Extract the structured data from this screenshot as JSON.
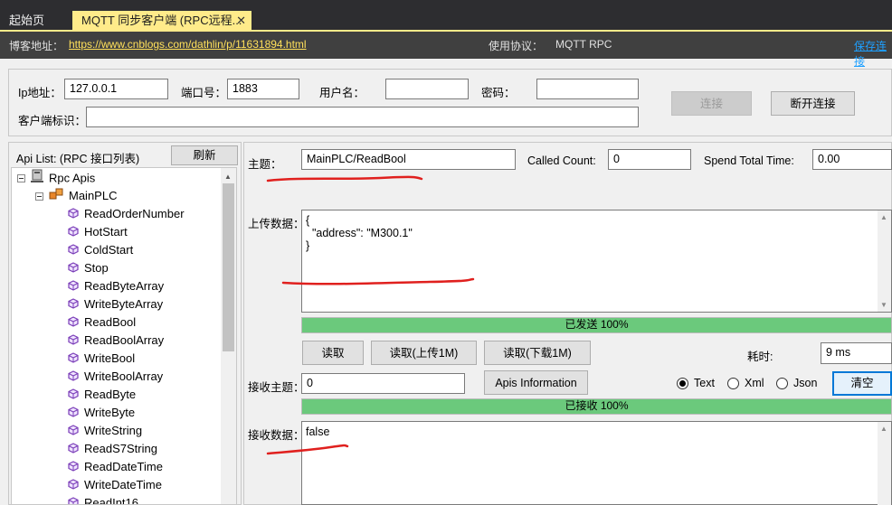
{
  "tabs": [
    {
      "label": "起始页"
    },
    {
      "label": "MQTT 同步客户端 (RPC远程...",
      "close": "✕"
    }
  ],
  "infobar": {
    "blog_label": "博客地址：",
    "blog_url": "https://www.cnblogs.com/dathlin/p/11631894.html",
    "protocol_label": "使用协议：",
    "protocol_value": "MQTT RPC",
    "save_link": "保存连接"
  },
  "connection": {
    "ip_label": "Ip地址：",
    "ip_value": "127.0.0.1",
    "port_label": "端口号：",
    "port_value": "1883",
    "user_label": "用户名：",
    "user_value": "",
    "password_label": "密码：",
    "password_value": "",
    "client_id_label": "客户端标识：",
    "client_id_value": "",
    "connect_button": "连接",
    "disconnect_button": "断开连接"
  },
  "api_list": {
    "header": "Api List: (RPC 接口列表)",
    "refresh_button": "刷新",
    "root": "Rpc Apis",
    "group": "MainPLC",
    "items": [
      "ReadOrderNumber",
      "HotStart",
      "ColdStart",
      "Stop",
      "ReadByteArray",
      "WriteByteArray",
      "ReadBool",
      "ReadBoolArray",
      "WriteBool",
      "WriteBoolArray",
      "ReadByte",
      "WriteByte",
      "WriteString",
      "ReadS7String",
      "ReadDateTime",
      "WriteDateTime",
      "ReadInt16"
    ]
  },
  "rpc": {
    "topic_label": "主题：",
    "topic_value": "MainPLC/ReadBool",
    "called_count_label": "Called Count:",
    "called_count_value": "0",
    "spend_time_label": "Spend Total Time:",
    "spend_time_value": "0.00",
    "upload_label": "上传数据：",
    "upload_value": "{\n  \"address\": \"M300.1\"\n}",
    "send_progress_text": "已发送 100%",
    "send_progress": 1.0,
    "read_button": "读取",
    "read_upload_button": "读取(上传1M)",
    "read_download_button": "读取(下载1M)",
    "elapsed_label": "耗时:",
    "elapsed_value": "9 ms",
    "recv_topic_label": "接收主题：",
    "recv_topic_value": "0",
    "apis_info_button": "Apis Information",
    "format_options": [
      "Text",
      "Xml",
      "Json"
    ],
    "format_selected": "Text",
    "clear_button": "清空",
    "recv_progress_text": "已接收 100%",
    "recv_progress": 1.0,
    "recv_label": "接收数据：",
    "recv_value": "false"
  },
  "colors": {
    "tab_active": "#ffeb8a",
    "title_bar": "#2d2d30",
    "info_bar": "#404040",
    "progress": "#06b025",
    "annotation": "#e0201e"
  }
}
